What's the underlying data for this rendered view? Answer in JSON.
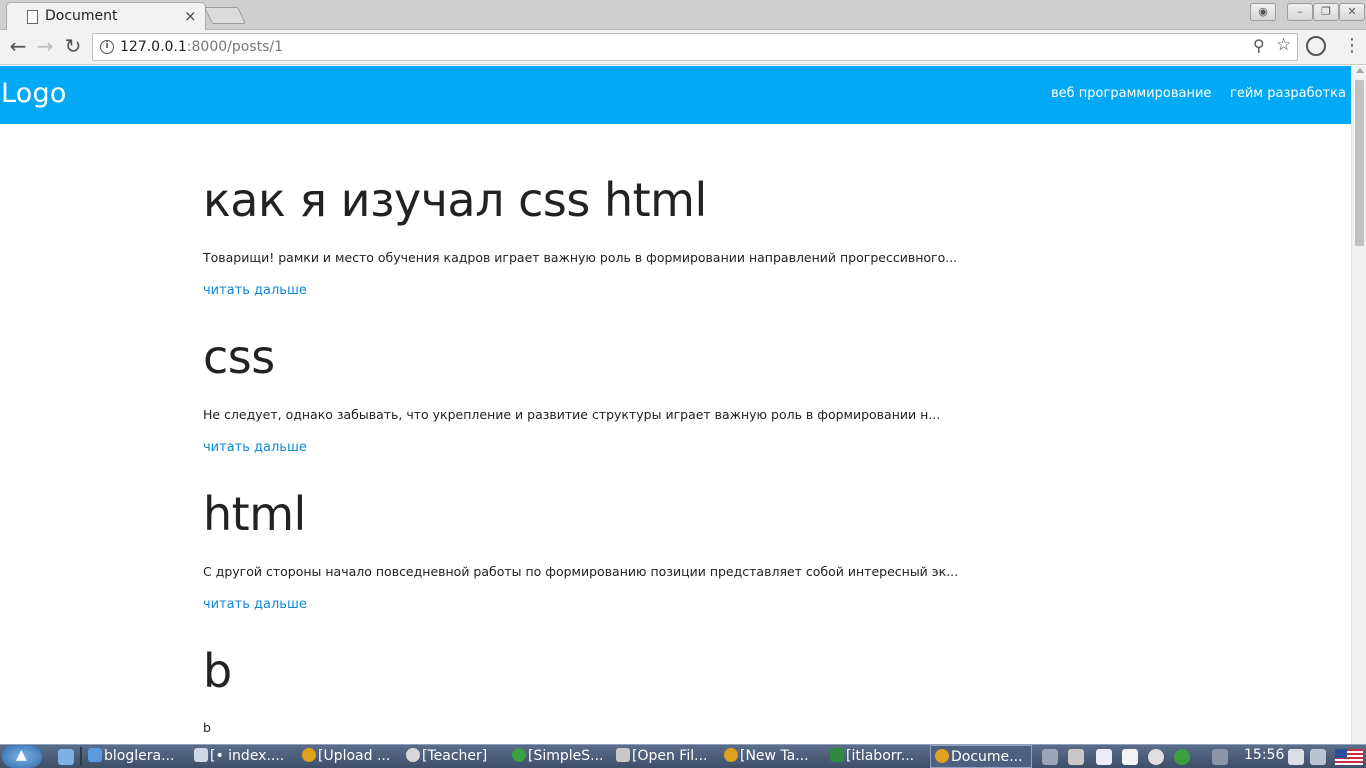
{
  "browser": {
    "tab_title": "Document",
    "tab_close": "×",
    "url_host": "127.0.0.1",
    "url_rest": ":8000/posts/1",
    "info_glyph": "i",
    "nav_back": "←",
    "nav_forward": "→",
    "nav_reload": "↻",
    "zoom_glyph": "⚲",
    "star_glyph": "☆",
    "menu_glyph": "⋮",
    "window_buttons": [
      "–",
      "❐",
      "✕"
    ],
    "profile_glyph": "◉"
  },
  "site": {
    "logo": "Logo",
    "nav": [
      "веб программирование",
      "гейм разработка"
    ],
    "accent": "#03a9f4",
    "link_color": "#0f8ad6"
  },
  "posts": [
    {
      "title": "как я изучал css html",
      "excerpt": "Товарищи! рамки и место обучения кадров играет важную роль в формировании направлений прогрессивного...",
      "link": "читать дальше"
    },
    {
      "title": "css",
      "excerpt": "Не следует, однако забывать, что укрепление и развитие структуры играет важную роль в формировании н...",
      "link": "читать дальше"
    },
    {
      "title": "html",
      "excerpt": "С другой стороны начало повседневной работы по формированию позиции представляет собой интересный эк...",
      "link": "читать дальше"
    },
    {
      "title": "b",
      "excerpt": "b"
    }
  ],
  "taskbar": {
    "items": [
      {
        "label": "bloglera...",
        "icon": "folder-icon",
        "color": "#5a9ae0"
      },
      {
        "label": "[• index....",
        "icon": "editor-icon",
        "color": "#d0d8e8"
      },
      {
        "label": "[Upload ...",
        "icon": "chrome-icon",
        "color": "#e0a020"
      },
      {
        "label": "[Teacher]",
        "icon": "pidgin-icon",
        "color": "#d8d8d8"
      },
      {
        "label": "[SimpleS...",
        "icon": "app-icon",
        "color": "#3aa040"
      },
      {
        "label": "[Open Fil...",
        "icon": "dialog-icon",
        "color": "#c8c8c8"
      },
      {
        "label": "[New Ta...",
        "icon": "chrome-icon",
        "color": "#e0a020"
      },
      {
        "label": "[itlaborr...",
        "icon": "terminal-icon",
        "color": "#2e8b3e"
      },
      {
        "label": "Docume...",
        "icon": "chrome-icon",
        "color": "#e0a020"
      }
    ],
    "clock": "15:56"
  }
}
